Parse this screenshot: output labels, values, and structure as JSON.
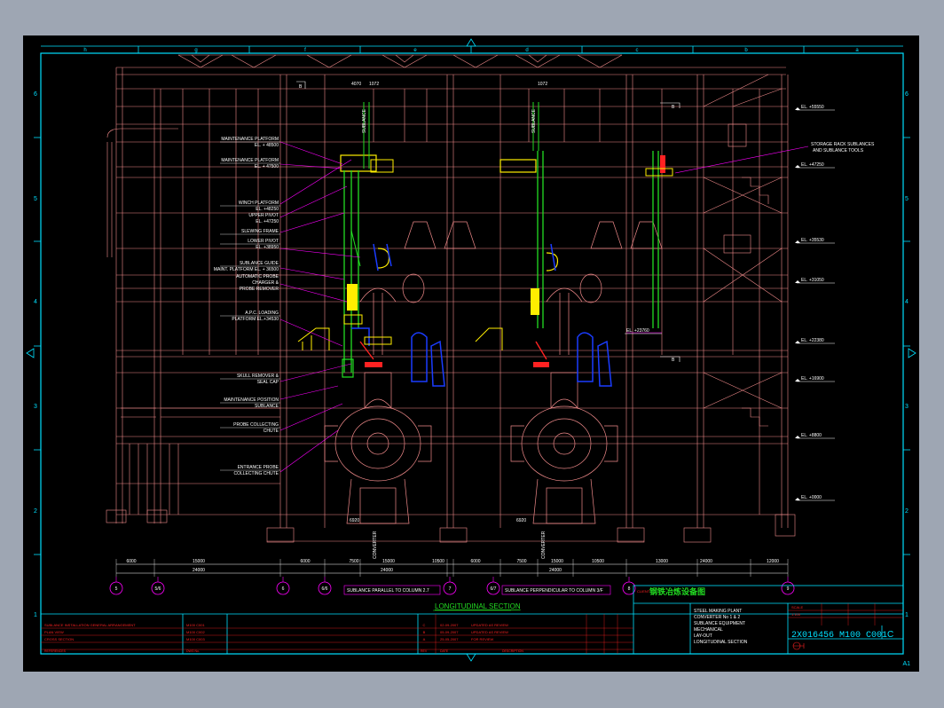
{
  "colors": {
    "background": "#000000",
    "frame": "#00e0ff",
    "structure": "#f08a8a",
    "equipment_green": "#22dd22",
    "equipment_yellow": "#ffee00",
    "equipment_blue": "#1a3cff",
    "leader_magenta": "#ff00ff",
    "window_bg": "#9ea6b3"
  },
  "border": {
    "top_letters": [
      "h",
      "g",
      "f",
      "e",
      "d",
      "c",
      "b",
      "a"
    ],
    "side_numbers": [
      "6",
      "5",
      "4",
      "3",
      "2",
      "1"
    ],
    "corner_mark": "A1"
  },
  "callouts_left": [
    "MAINTENANCE PLATFORM",
    "EL. + 48500",
    "MAINTENANCE PLATFORM",
    "EL. + 47500",
    "WINCH PLATFORM",
    "EL. +48250",
    "UPPER PIVOT",
    "EL. +47250",
    "SLEWING FRAME",
    "LOWER PIVOT",
    "EL. +38950",
    "SUBLANCE GUIDE",
    "MAINT. PLATFORM EL. + 36500",
    "AUTOMATIC PROBE",
    "CHARGER &",
    "PROBE REMOVER",
    "A.P.C. LOADING",
    "PLATFORM EL.+34530",
    "SKULL REMOVER &",
    "SEAL CAP",
    "MAINTENANCE POSITION",
    "SUBLANCE",
    "PROBE COLLECTING",
    "CHUTE",
    "ENTRANCE PROBE",
    "COLLECTING CHUTE"
  ],
  "callouts_right": [
    "STORAGE RACK SUBLANCES",
    "AND SUBLANCE TOOLS"
  ],
  "elevations_right": [
    "EL. +55550",
    "EL. +47250",
    "EL. +35530",
    "EL. +31050",
    "EL. +22380",
    "EL. +16900",
    "EL. +8800",
    "EL. +0000"
  ],
  "elevation_inner": "EL. +23760",
  "top_dims": [
    "4070",
    "1072",
    "1072"
  ],
  "section_marks": [
    "B",
    "B",
    "B"
  ],
  "dims_row1": [
    "6000",
    "15000",
    "6000",
    "7500",
    "15000",
    "10500",
    "6000",
    "7500",
    "15000",
    "10500",
    "13000",
    "24000",
    "12000"
  ],
  "dims_row2": [
    "24000",
    "24000",
    "24000"
  ],
  "bottom_dims": [
    "6920",
    "6920"
  ],
  "columns": [
    "5",
    "5/6",
    "6",
    "6/6",
    "7",
    "6/7",
    "8",
    "9"
  ],
  "notes": {
    "parallel": "SUBLANCE PARALLEL TO COLUMN 2.7",
    "perpendicular": "SUBLANCE PERPENDICULAR TO COLUMN 3/F",
    "section_title": "LONGITUDINAL SECTION"
  },
  "vertical_labels": [
    "SUBLANCE",
    "SUBLANCE",
    "CONVERTER",
    "CONVERTER"
  ],
  "title_block": {
    "client_label": "CLIENT",
    "client_name": "钢铁冶炼设备图",
    "description": [
      "STEEL MAKING PLANT",
      "CONVERTER No 1 & 2",
      "SUBLANCE EQUIPMENT",
      "MECHANICAL",
      "LAY-OUT",
      "LONGITUDINAL SECTION"
    ],
    "drawing_number": "2X016456 M100 C001",
    "revision": "C",
    "scale_label": "SCALE",
    "scale": "1:100",
    "revisions": [
      {
        "rev": "C",
        "date": "02-09-2007",
        "desc": "UPDATED AS REVIEW"
      },
      {
        "rev": "B",
        "date": "05-09-2007",
        "desc": "UPDATED AS REVIEW"
      },
      {
        "rev": "A",
        "date": "25-05-2007",
        "desc": "FOR REVIEW"
      }
    ],
    "rev_headers": [
      "REV",
      "DATE",
      "DESCRIPTION"
    ],
    "ref_rows": [
      "SUBLANCE INSTALLATION GENERAL ARRANGEMENT",
      "PLAN VIEW",
      "CROSS SECTION"
    ],
    "ref_numbers": [
      "M100 C001",
      "M100 C002",
      "M100 C003"
    ],
    "ref_header": "REFERENCES",
    "ref_header_no": "DWG No."
  }
}
